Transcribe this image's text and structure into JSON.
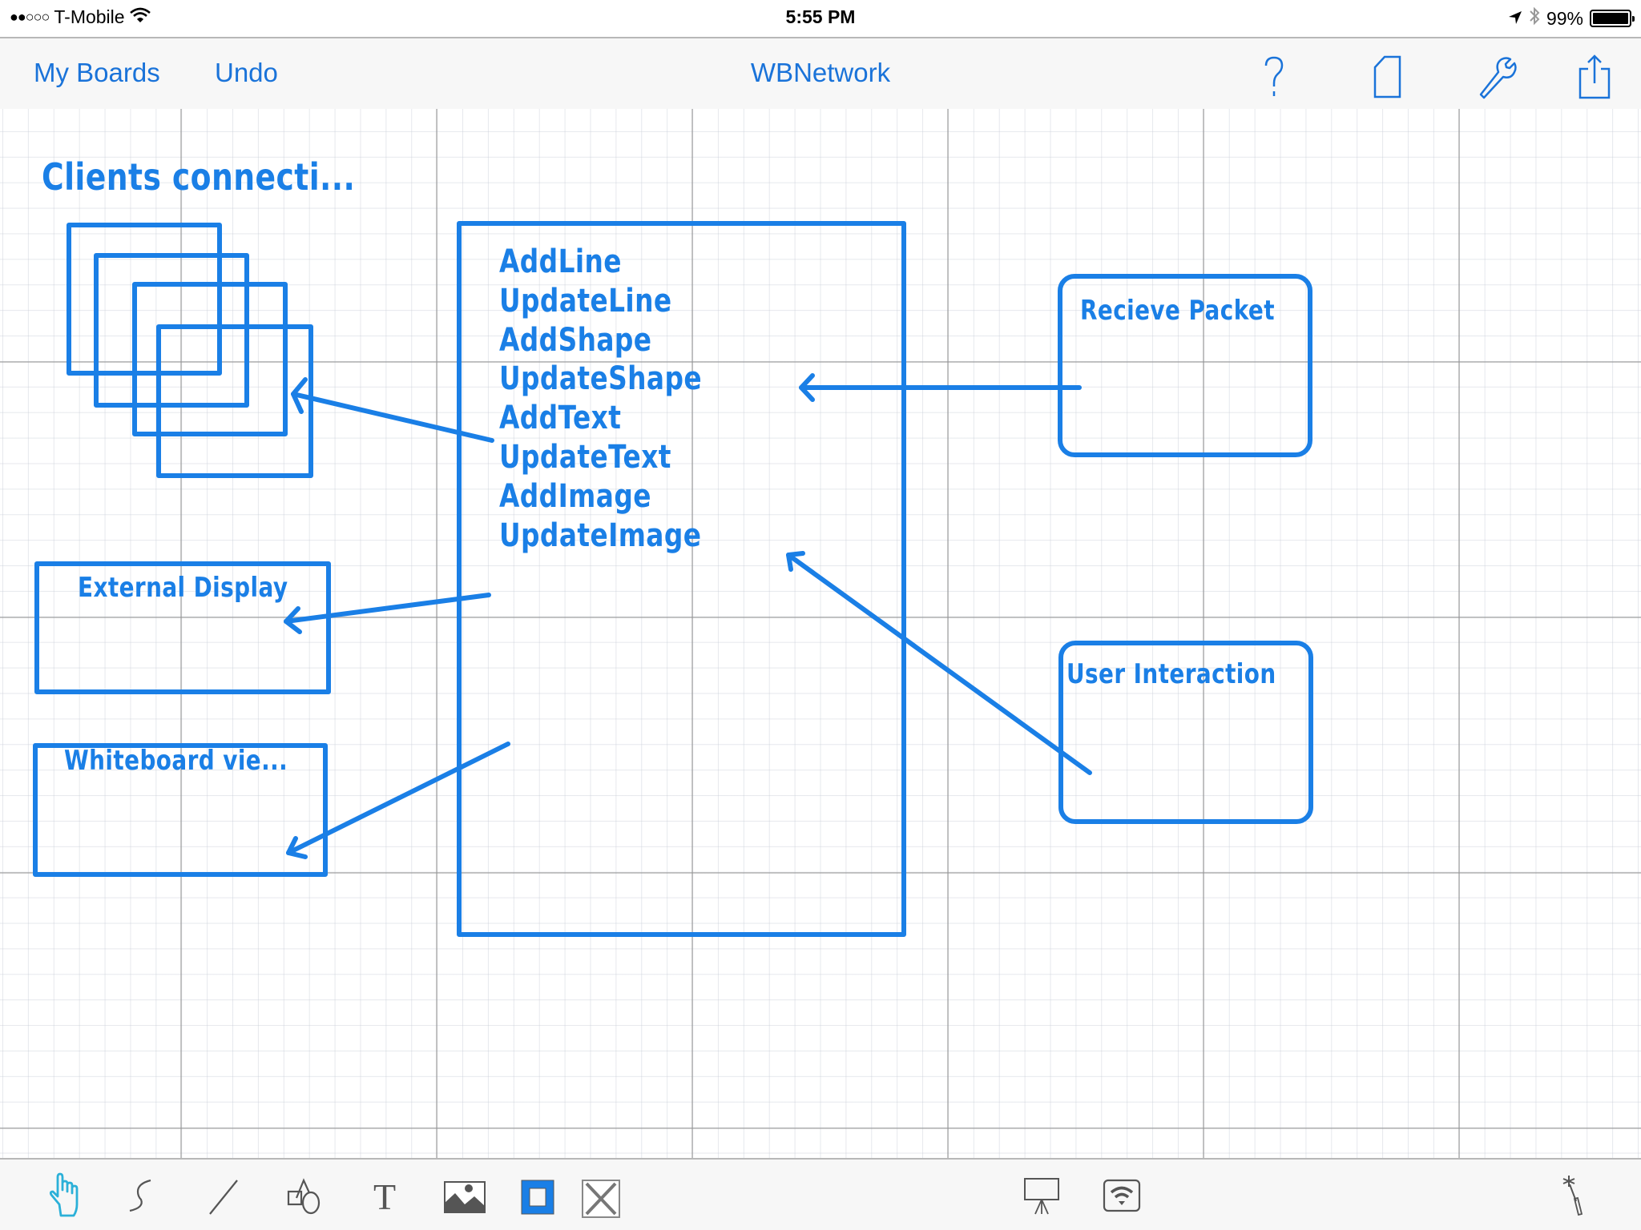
{
  "status_bar": {
    "signal_dots": "●●○○○",
    "carrier": "T-Mobile",
    "time": "5:55 PM",
    "battery_percent": "99%",
    "battery_level": 0.99
  },
  "nav": {
    "my_boards_label": "My Boards",
    "undo_label": "Undo",
    "board_title": "WBNetwork",
    "icons": [
      "help-icon",
      "page-icon",
      "wrench-icon",
      "share-icon"
    ]
  },
  "canvas": {
    "title": "Clients connecti...",
    "commands": [
      "AddLine",
      "UpdateLine",
      "AddShape",
      "UpdateShape",
      "AddText",
      "UpdateText",
      "AddImage",
      "UpdateImage"
    ],
    "boxes": {
      "external_display": "External Display",
      "whiteboard_view": "Whiteboard vie...",
      "receive_packet": "Recieve Packet",
      "user_interaction": "User Interaction"
    },
    "ink_color": "#1a7fe6"
  },
  "toolbar": {
    "tools": [
      "pointer-hand",
      "freehand-curve",
      "line",
      "shapes",
      "text",
      "image",
      "stroke-style",
      "fill-none"
    ],
    "right_tools": [
      "present",
      "network-share",
      "magic-wand"
    ],
    "active_tool": "pointer-hand",
    "active_color": "#2bb0d8",
    "icon_color": "#555555"
  }
}
